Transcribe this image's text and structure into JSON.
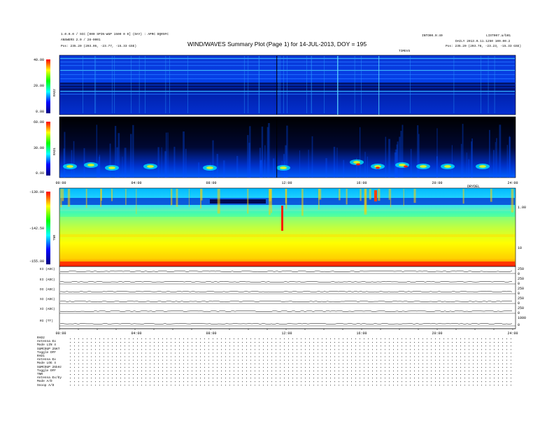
{
  "header": {
    "left_line1": "1.0.0.0 / SCC [000 SPIN-WUP 1500 0 0] (DAY)  :  APRC DQRSFC",
    "left_line2": "ANSWERS 2.0 / 28-0001",
    "left_line3": "Pos:    235.20 (203.05, -23.77, -15.33 GSE)",
    "right_top": "INTO00.0:40",
    "right_top2": "LIST007.a/b01",
    "right_line2": "DAILY  2013.0.11.1250  100.00.2",
    "right_line3": "Pos:    235.20 (203.78, -23.23, -15.33 GSE)",
    "right_sub": "TIMEVS"
  },
  "chart_data": {
    "type": "heatmap",
    "title": "WIND/WAVES Summary Plot (Page 1) for 14-JUL-2013, DOY = 195",
    "panels": [
      {
        "name": "RAD2",
        "ylim": [
          0,
          40
        ],
        "yticks": [
          "40.00",
          "20.00",
          "0.00"
        ]
      },
      {
        "name": "RAD1",
        "ylim": [
          0,
          60
        ],
        "yticks": [
          "60.00",
          "30.00",
          "0.00"
        ]
      },
      {
        "name": "TNR",
        "ylim": [
          -155,
          -130
        ],
        "yticks": [
          "-130.00",
          "-142.50",
          "-155.00"
        ],
        "right_ticks": [
          "1.00",
          "10"
        ]
      }
    ],
    "x_ticks_top": [
      "00:00",
      "04:00",
      "08:00",
      "12:00",
      "16:00",
      "20:00",
      "24:00"
    ],
    "x_ticks_bottom": [
      "00:00",
      "04:00",
      "08:00",
      "12:00",
      "16:00",
      "20:00",
      "24:00"
    ],
    "x_label_small": "DRYDEL",
    "lineplots": [
      {
        "label": "EI (ADC)",
        "right": [
          "250",
          "0"
        ]
      },
      {
        "label": "EI (ADC)",
        "right": [
          "250",
          "0"
        ]
      },
      {
        "label": "DI (ADC)",
        "right": [
          "250",
          "0"
        ]
      },
      {
        "label": "SI (ADC)",
        "right": [
          "250",
          "0"
        ]
      },
      {
        "label": "XI (ADC)",
        "right": [
          "250",
          "0"
        ]
      },
      {
        "label": "RI (TT)",
        "right": [
          "1000",
          "0"
        ]
      }
    ]
  },
  "info_blocks": [
    {
      "lines": [
        "RAD2",
        "Antenna   Ex",
        "Mode    LIN 4",
        "SUMCOUP  25KT",
        "Toggle    OFF"
      ]
    },
    {
      "lines": [
        "RAD1",
        "Antenna   Ex",
        "Mode   LOG 4",
        "SUMCOUP 25kHz",
        "Toggle    OFF"
      ]
    },
    {
      "lines": [
        "TNR",
        "Antenna  Ex/Ey",
        "Mode     A/D",
        "Snoop    A/D"
      ]
    }
  ],
  "colors": {
    "dark_blue": "#000080",
    "blue": "#0000ff",
    "cyan": "#00ffff",
    "yellow": "#ffff00",
    "red": "#ff0000"
  }
}
